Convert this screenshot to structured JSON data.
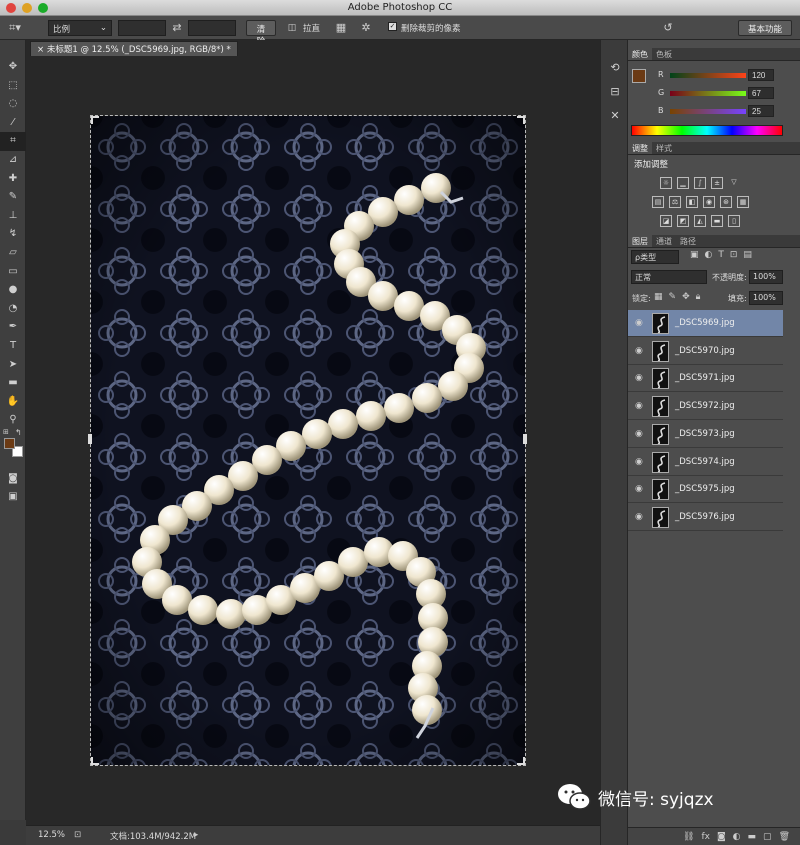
{
  "window": {
    "title": "Adobe Photoshop CC"
  },
  "options_bar": {
    "ratio_select": "比例",
    "clear_button": "清除",
    "straighten_label": "拉直",
    "delete_cropped_label": "删除裁剪的像素",
    "workspace_button": "基本功能"
  },
  "document": {
    "tab_title": "未标题1 @ 12.5% (_DSC5969.jpg, RGB/8*) *",
    "zoom": "12.5%",
    "doc_size": "文档:103.4M/942.2M"
  },
  "colors": {
    "foreground": "#6b3a14",
    "background": "#ffffff",
    "selected_layer": "#7286a8"
  },
  "color_panel": {
    "tabs": [
      "颜色",
      "色板"
    ],
    "channels": [
      {
        "label": "R",
        "value": "120"
      },
      {
        "label": "G",
        "value": "67"
      },
      {
        "label": "B",
        "value": "25"
      }
    ]
  },
  "adjust_panel": {
    "tabs": [
      "调整",
      "样式"
    ],
    "heading": "添加调整"
  },
  "layers_panel": {
    "tabs": [
      "图层",
      "通道",
      "路径"
    ],
    "filter_type": "ρ类型",
    "blend_mode": "正常",
    "opacity_label": "不透明度:",
    "opacity_value": "100%",
    "lock_label": "锁定:",
    "fill_label": "填充:",
    "fill_value": "100%",
    "layers": [
      {
        "name": "_DSC5969.jpg",
        "selected": true
      },
      {
        "name": "_DSC5970.jpg",
        "selected": false
      },
      {
        "name": "_DSC5971.jpg",
        "selected": false
      },
      {
        "name": "_DSC5972.jpg",
        "selected": false
      },
      {
        "name": "_DSC5973.jpg",
        "selected": false
      },
      {
        "name": "_DSC5974.jpg",
        "selected": false
      },
      {
        "name": "_DSC5975.jpg",
        "selected": false
      },
      {
        "name": "_DSC5976.jpg",
        "selected": false
      }
    ]
  },
  "watermark": {
    "text": "微信号: syjqzx"
  }
}
